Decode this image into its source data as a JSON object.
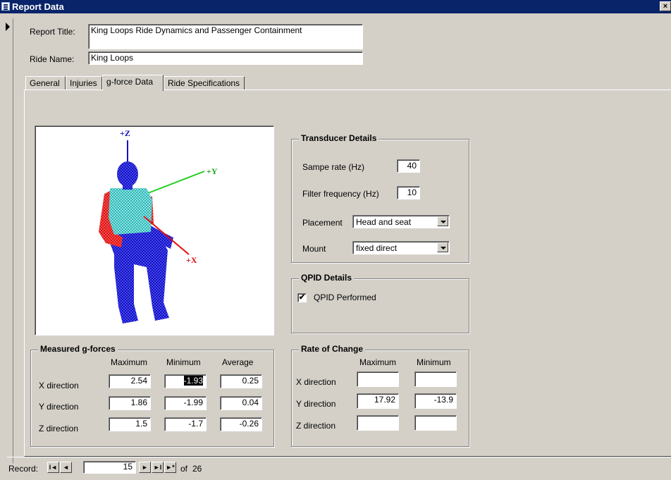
{
  "window": {
    "title": "Report Data",
    "close_glyph": "×"
  },
  "header": {
    "report_title_label": "Report Title:",
    "report_title_value": "King Loops Ride Dynamics and Passenger Containment",
    "ride_name_label": "Ride Name:",
    "ride_name_value": "King Loops"
  },
  "tabs": [
    {
      "label": "General"
    },
    {
      "label": "Injuries"
    },
    {
      "label": "g-force Data",
      "active": true
    },
    {
      "label": "Ride Specifications"
    }
  ],
  "figure": {
    "axis_z": "+Z",
    "axis_y": "+Y",
    "axis_x": "+X"
  },
  "transducer": {
    "title": "Transducer Details",
    "sample_rate_label": "Sampe rate (Hz)",
    "sample_rate_value": "40",
    "filter_label": "Filter frequency (Hz)",
    "filter_value": "10",
    "placement_label": "Placement",
    "placement_value": "Head and seat",
    "mount_label": "Mount",
    "mount_value": "fixed direct"
  },
  "qpid": {
    "title": "QPID Details",
    "performed_label": "QPID Performed",
    "performed": true,
    "check_glyph": "✔"
  },
  "measured": {
    "title": "Measured g-forces",
    "columns": [
      "Maximum",
      "Minimum",
      "Average"
    ],
    "rows": [
      {
        "label": "X direction",
        "max": "2.54",
        "min": "-1.93",
        "avg": "0.25"
      },
      {
        "label": "Y direction",
        "max": "1.86",
        "min": "-1.99",
        "avg": "0.04"
      },
      {
        "label": "Z direction",
        "max": "1.5",
        "min": "-1.7",
        "avg": "-0.26"
      }
    ]
  },
  "rate": {
    "title": "Rate of Change",
    "columns": [
      "Maximum",
      "Minimum"
    ],
    "rows": [
      {
        "label": "X direction",
        "max": "",
        "min": ""
      },
      {
        "label": "Y direction",
        "max": "17.92",
        "min": "-13.9"
      },
      {
        "label": "Z direction",
        "max": "",
        "min": ""
      }
    ]
  },
  "navigation": {
    "record_label": "Record:",
    "current": "15",
    "of_label": "of",
    "total": "26",
    "first_glyph": "I◄",
    "prev_glyph": "◄",
    "next_glyph": "►",
    "last_glyph": "►I",
    "new_glyph": "►*"
  }
}
